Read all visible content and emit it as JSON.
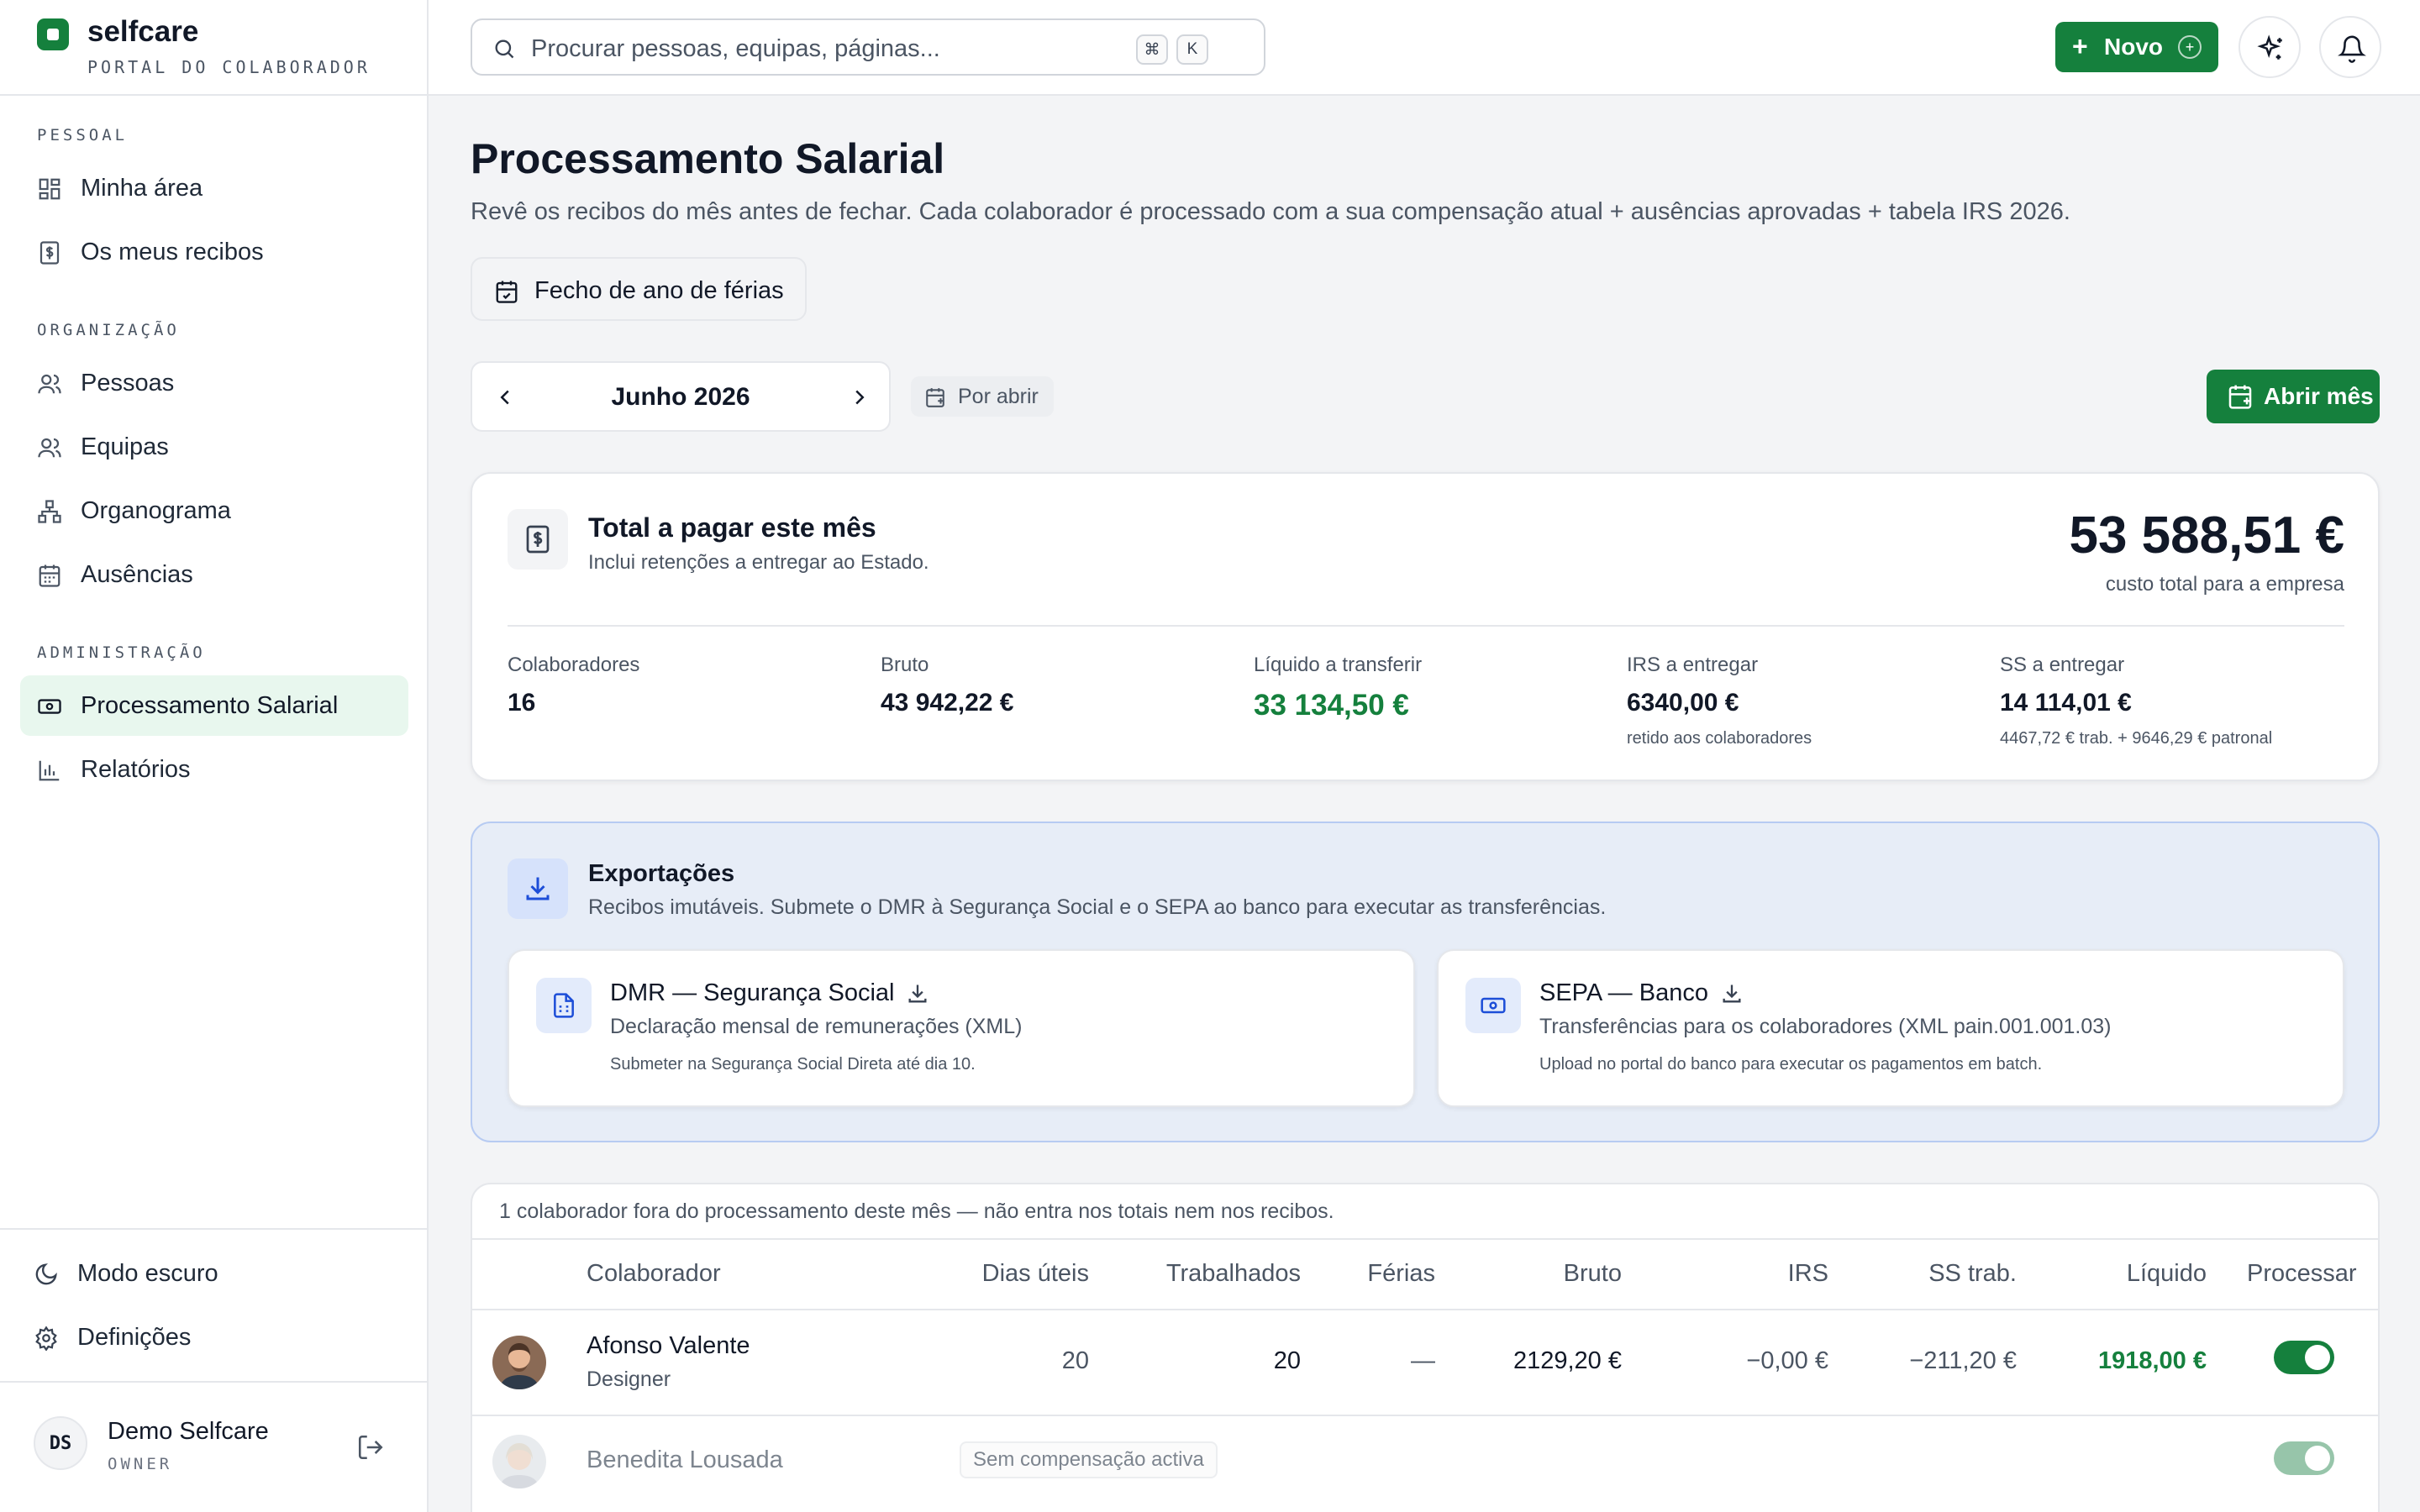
{
  "brand": {
    "name": "selfcare",
    "subtitle": "PORTAL DO COLABORADOR"
  },
  "sidebar": {
    "sections": [
      "PESSOAL",
      "ORGANIZAÇÃO",
      "ADMINISTRAÇÃO"
    ],
    "items": [
      {
        "label": "Minha área",
        "icon": "grid-icon"
      },
      {
        "label": "Os meus recibos",
        "icon": "receipt-icon"
      },
      {
        "label": "Pessoas",
        "icon": "users-icon"
      },
      {
        "label": "Equipas",
        "icon": "team-icon"
      },
      {
        "label": "Organograma",
        "icon": "org-chart-icon"
      },
      {
        "label": "Ausências",
        "icon": "calendar-icon"
      },
      {
        "label": "Processamento Salarial",
        "icon": "banknote-icon",
        "active": true
      },
      {
        "label": "Relatórios",
        "icon": "bar-chart-icon"
      }
    ],
    "dark_mode": "Modo escuro",
    "settings": "Definições",
    "user": {
      "initials": "DS",
      "name": "Demo Selfcare",
      "role": "OWNER"
    }
  },
  "topbar": {
    "search_placeholder": "Procurar pessoas, equipas, páginas...",
    "kbd_cmd": "⌘",
    "kbd_k": "K",
    "new_button": "Novo",
    "new_plus": "+"
  },
  "page": {
    "title": "Processamento Salarial",
    "description": "Revê os recibos do mês antes de fechar. Cada colaborador é processado com a sua compensação atual + ausências aprovadas + tabela IRS 2026.",
    "vacation_close_button": "Fecho de ano de férias",
    "month": "Junho 2026",
    "status": "Por abrir",
    "open_month_button": "Abrir mês"
  },
  "summary": {
    "title": "Total a pagar este mês",
    "subtitle": "Inclui retenções a entregar ao Estado.",
    "total": "53 588,51 €",
    "total_label": "custo total para a empresa",
    "stats": [
      {
        "label": "Colaboradores",
        "value": "16",
        "note": ""
      },
      {
        "label": "Bruto",
        "value": "43 942,22 €",
        "note": ""
      },
      {
        "label": "Líquido a transferir",
        "value": "33 134,50 €",
        "note": ""
      },
      {
        "label": "IRS a entregar",
        "value": "6340,00 €",
        "note": "retido aos colaboradores"
      },
      {
        "label": "SS a entregar",
        "value": "14 114,01 €",
        "note": "4467,72 € trab. + 9646,29 € patronal"
      }
    ]
  },
  "exports": {
    "title": "Exportações",
    "subtitle": "Recibos imutáveis. Submete o DMR à Segurança Social e o SEPA ao banco para executar as transferências.",
    "cards": [
      {
        "title": "DMR — Segurança Social",
        "desc": "Declaração mensal de remunerações (XML)",
        "note": "Submeter na Segurança Social Direta até dia 10."
      },
      {
        "title": "SEPA — Banco",
        "desc": "Transferências para os colaboradores (XML pain.001.001.03)",
        "note": "Upload no portal do banco para executar os pagamentos em batch."
      }
    ]
  },
  "table": {
    "note": "1 colaborador fora do processamento deste mês — não entra nos totais nem nos recibos.",
    "columns": [
      "Colaborador",
      "Dias úteis",
      "Trabalhados",
      "Férias",
      "Bruto",
      "IRS",
      "SS trab.",
      "Líquido",
      "Processar"
    ],
    "rows": [
      {
        "name": "Afonso Valente",
        "role": "Designer",
        "dias_uteis": "20",
        "trabalhados": "20",
        "ferias": "—",
        "bruto": "2129,20 €",
        "irs": "−0,00 €",
        "ss": "−211,20 €",
        "liquido": "1918,00 €",
        "process": true
      },
      {
        "name": "Benedita Lousada",
        "badge": "Sem compensação activa",
        "process": true
      }
    ]
  },
  "colors": {
    "brand_green": "#15803d",
    "active_bg": "#e8f7ee",
    "export_bg": "#e7edf7"
  }
}
